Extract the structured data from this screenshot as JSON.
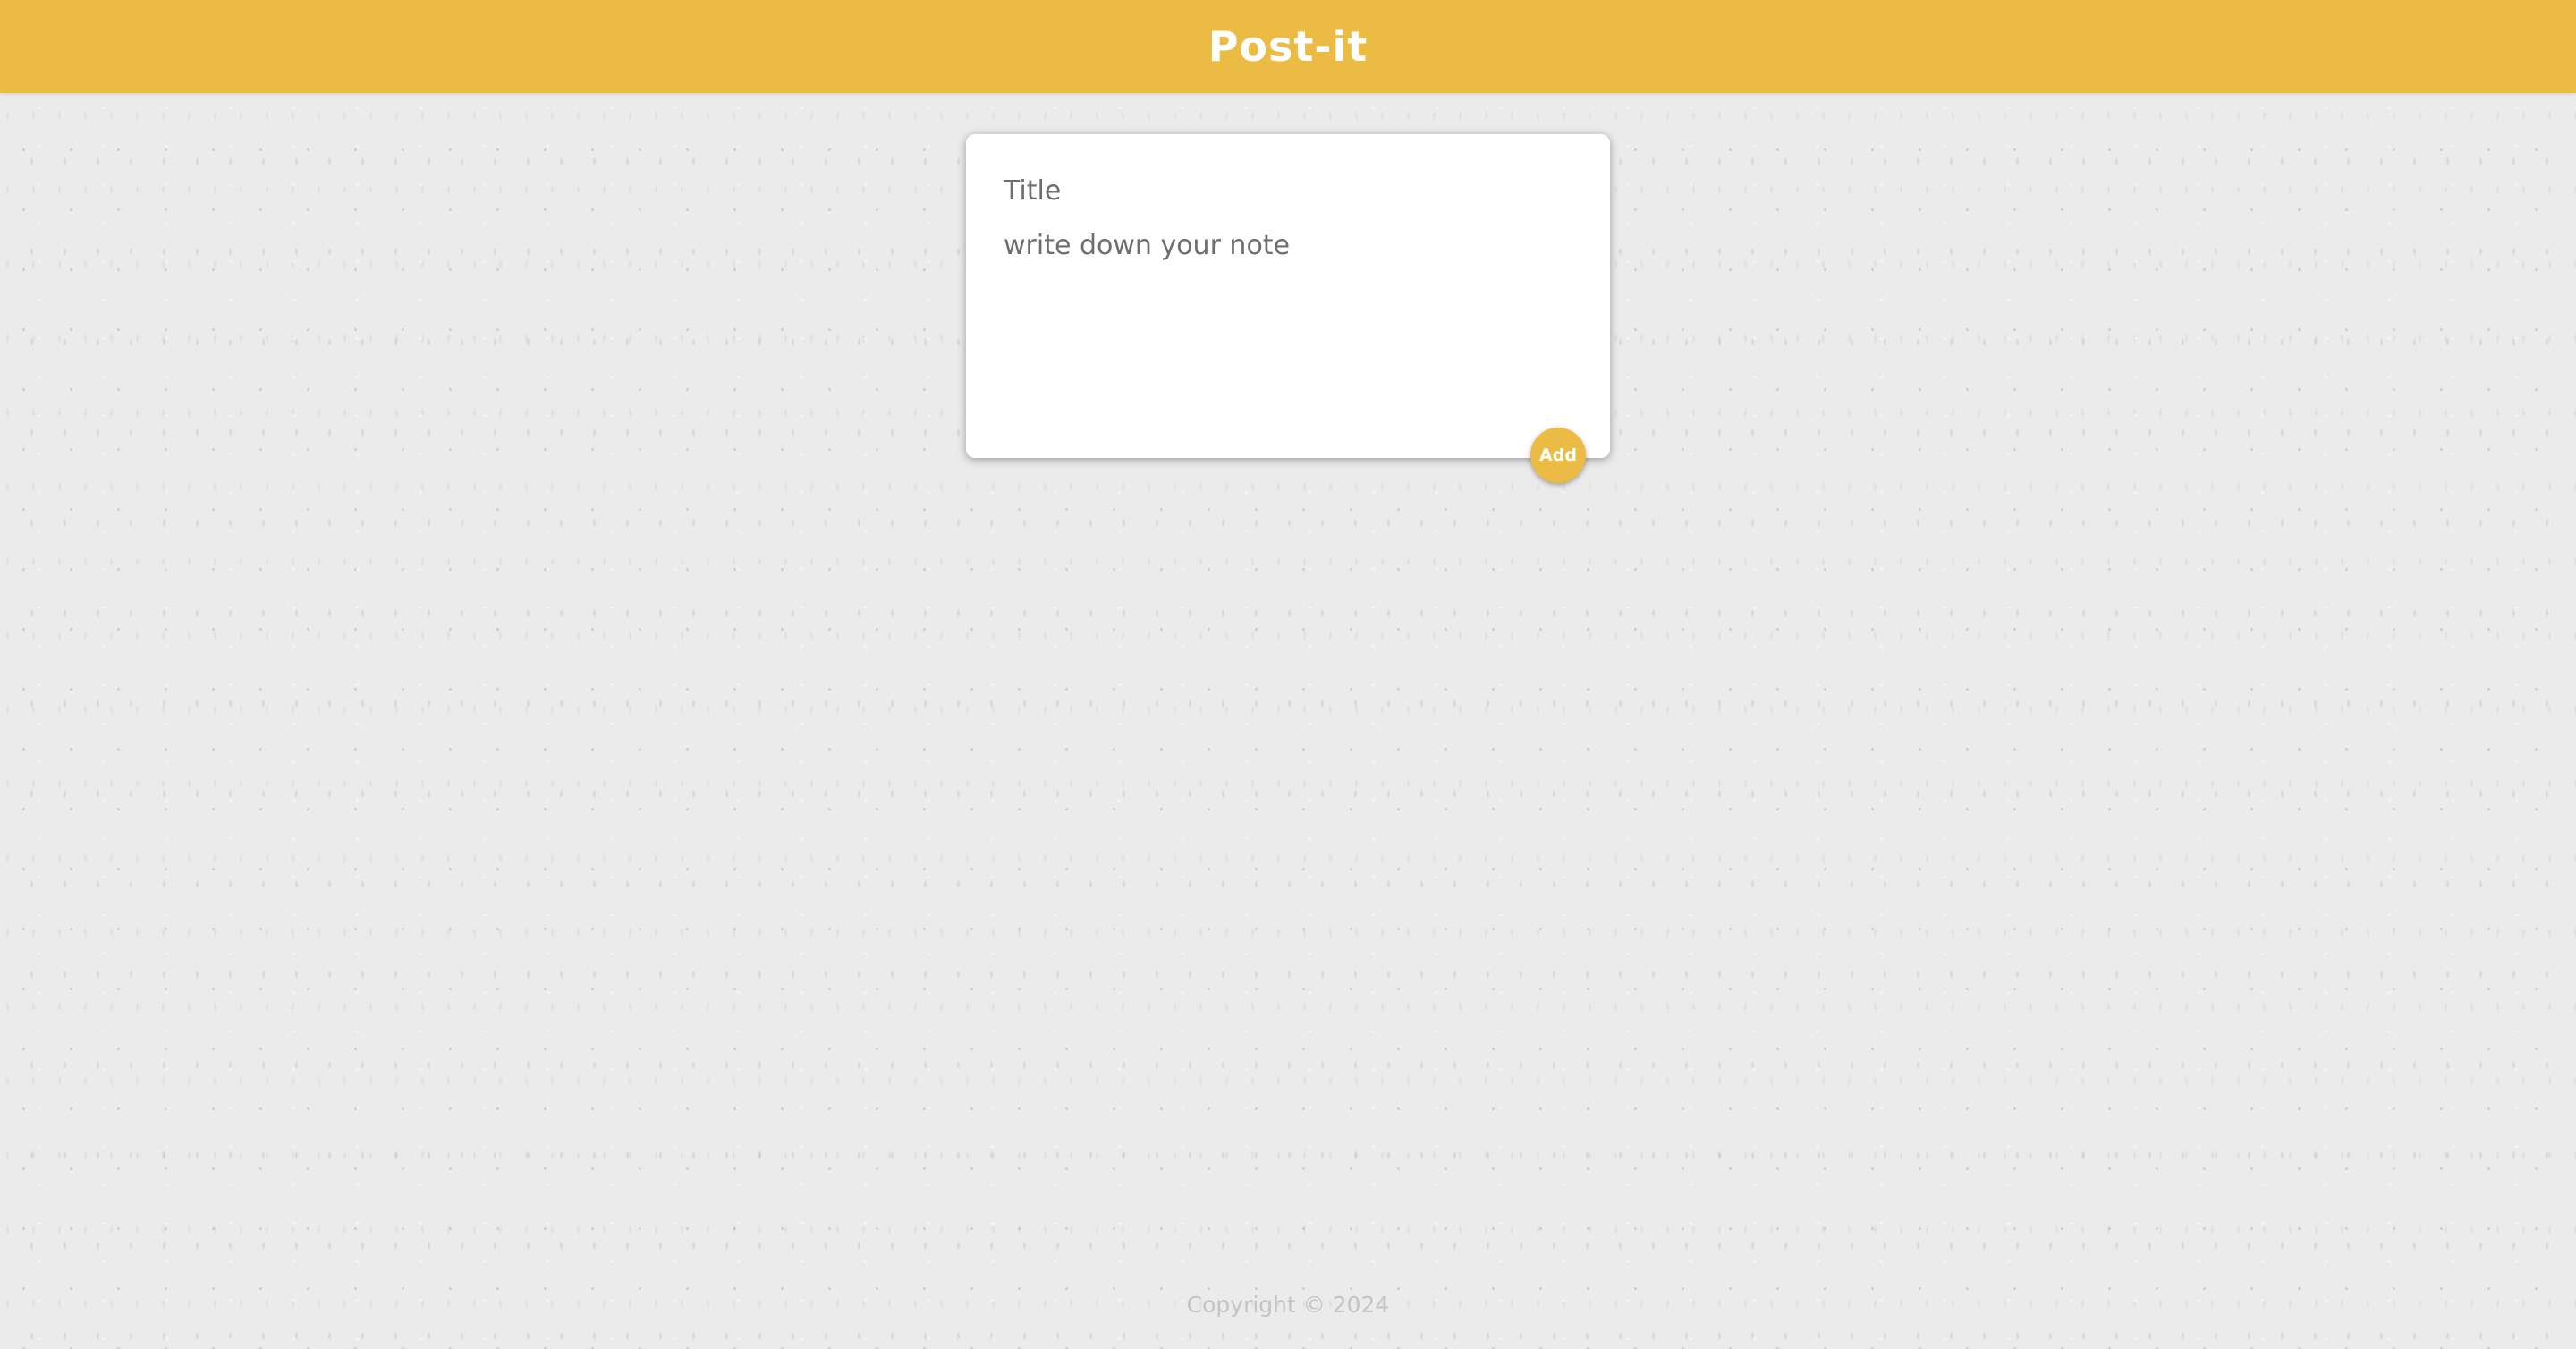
{
  "header": {
    "title": "Post-it"
  },
  "note_form": {
    "title_placeholder": "Title",
    "content_placeholder": "write down your note",
    "add_label": "Add"
  },
  "footer": {
    "copyright": "Copyright © 2024"
  },
  "colors": {
    "accent": "#ebbb43",
    "background": "#ebebeb",
    "card": "#ffffff"
  }
}
